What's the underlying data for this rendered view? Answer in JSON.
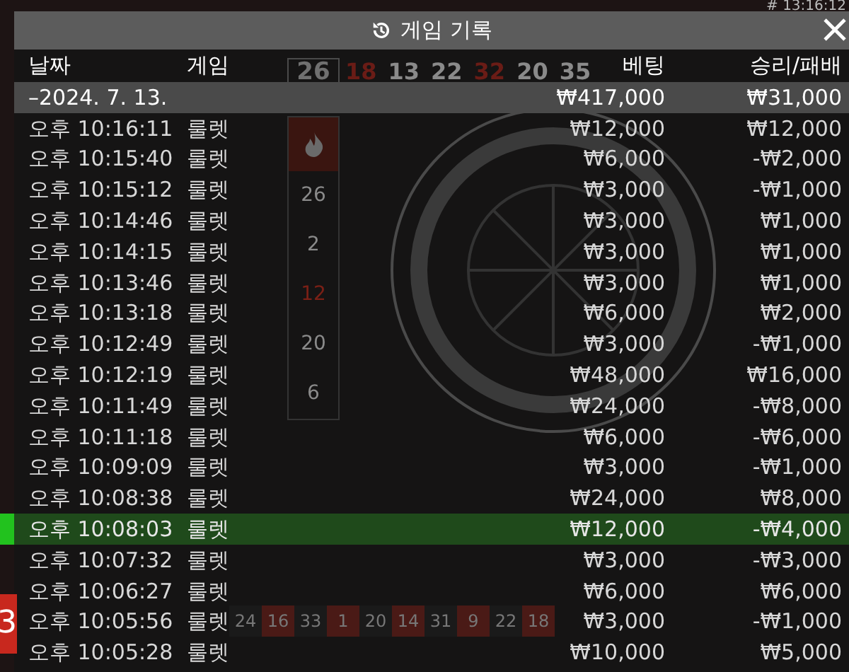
{
  "clock": "# 13:16:12",
  "dialog": {
    "title": "게임 기록",
    "columns": [
      "날짜",
      "게임",
      "베팅",
      "승리/패배"
    ],
    "summary": {
      "date": "–2024. 7. 13.",
      "bet": "₩417,000",
      "result": "₩31,000"
    },
    "rows": [
      {
        "time": "오후 10:16:11",
        "game": "룰렛",
        "bet": "₩12,000",
        "result": "₩12,000",
        "selected": false
      },
      {
        "time": "오후 10:15:40",
        "game": "룰렛",
        "bet": "₩6,000",
        "result": "-₩2,000",
        "selected": false
      },
      {
        "time": "오후 10:15:12",
        "game": "룰렛",
        "bet": "₩3,000",
        "result": "-₩1,000",
        "selected": false
      },
      {
        "time": "오후 10:14:46",
        "game": "룰렛",
        "bet": "₩3,000",
        "result": "₩1,000",
        "selected": false
      },
      {
        "time": "오후 10:14:15",
        "game": "룰렛",
        "bet": "₩3,000",
        "result": "₩1,000",
        "selected": false
      },
      {
        "time": "오후 10:13:46",
        "game": "룰렛",
        "bet": "₩3,000",
        "result": "₩1,000",
        "selected": false
      },
      {
        "time": "오후 10:13:18",
        "game": "룰렛",
        "bet": "₩6,000",
        "result": "₩2,000",
        "selected": false
      },
      {
        "time": "오후 10:12:49",
        "game": "룰렛",
        "bet": "₩3,000",
        "result": "-₩1,000",
        "selected": false
      },
      {
        "time": "오후 10:12:19",
        "game": "룰렛",
        "bet": "₩48,000",
        "result": "₩16,000",
        "selected": false
      },
      {
        "time": "오후 10:11:49",
        "game": "룰렛",
        "bet": "₩24,000",
        "result": "-₩8,000",
        "selected": false
      },
      {
        "time": "오후 10:11:18",
        "game": "룰렛",
        "bet": "₩6,000",
        "result": "-₩6,000",
        "selected": false
      },
      {
        "time": "오후 10:09:09",
        "game": "룰렛",
        "bet": "₩3,000",
        "result": "-₩1,000",
        "selected": false
      },
      {
        "time": "오후 10:08:38",
        "game": "룰렛",
        "bet": "₩24,000",
        "result": "₩8,000",
        "selected": false
      },
      {
        "time": "오후 10:08:03",
        "game": "룰렛",
        "bet": "₩12,000",
        "result": "-₩4,000",
        "selected": true
      },
      {
        "time": "오후 10:07:32",
        "game": "룰렛",
        "bet": "₩3,000",
        "result": "-₩3,000",
        "selected": false
      },
      {
        "time": "오후 10:06:27",
        "game": "룰렛",
        "bet": "₩6,000",
        "result": "₩6,000",
        "selected": false
      },
      {
        "time": "오후 10:05:56",
        "game": "룰렛",
        "bet": "₩3,000",
        "result": "-₩1,000",
        "selected": false
      },
      {
        "time": "오후 10:05:28",
        "game": "룰렛",
        "bet": "₩10,000",
        "result": "₩5,000",
        "selected": false
      }
    ]
  },
  "recent_results": [
    {
      "value": "26",
      "color": "#707070"
    },
    {
      "value": "18",
      "color": "#6a1c16"
    },
    {
      "value": "13",
      "color": "#8a8a8a"
    },
    {
      "value": "22",
      "color": "#8a8a8a"
    },
    {
      "value": "32",
      "color": "#6a1c16"
    },
    {
      "value": "20",
      "color": "#8a8a8a"
    },
    {
      "value": "35",
      "color": "#8a8a8a"
    }
  ],
  "hot_numbers": [
    {
      "value": "26",
      "color": "#8a8a8a"
    },
    {
      "value": "2",
      "color": "#8a8a8a"
    },
    {
      "value": "12",
      "color": "#7a2016"
    },
    {
      "value": "20",
      "color": "#8a8a8a"
    },
    {
      "value": "6",
      "color": "#8a8a8a"
    }
  ],
  "racetrack": [
    {
      "value": "24",
      "color": "#1a1a1a"
    },
    {
      "value": "16",
      "color": "#4a1a16"
    },
    {
      "value": "33",
      "color": "#1a1a1a"
    },
    {
      "value": "1",
      "color": "#4a1a16"
    },
    {
      "value": "20",
      "color": "#1a1a1a"
    },
    {
      "value": "14",
      "color": "#4a1a16"
    },
    {
      "value": "31",
      "color": "#1a1a1a"
    },
    {
      "value": "9",
      "color": "#4a1a16"
    },
    {
      "value": "22",
      "color": "#1a1a1a"
    },
    {
      "value": "18",
      "color": "#4a1a16"
    }
  ],
  "last_result": "3"
}
